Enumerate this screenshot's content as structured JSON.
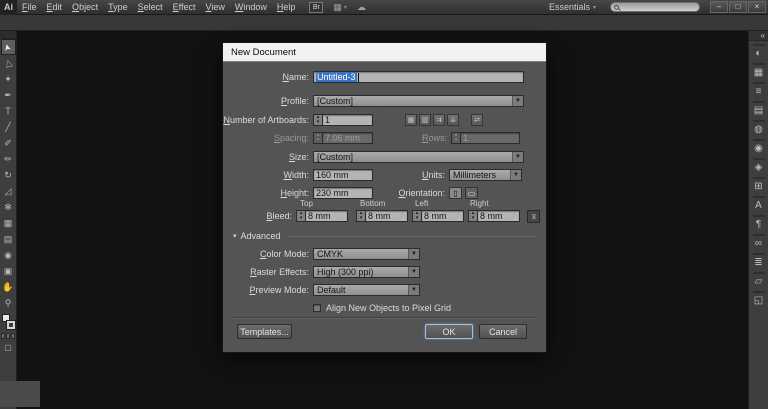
{
  "app": {
    "logo": "Ai",
    "menus": [
      "File",
      "Edit",
      "Object",
      "Type",
      "Select",
      "Effect",
      "View",
      "Window",
      "Help"
    ],
    "bridge_label": "Br",
    "workspace": "Essentials",
    "search_value": ""
  },
  "icons": {
    "arrange_documents": "▦",
    "cs_live": "☁",
    "workspace_caret": "▾",
    "dropdown_arrow": "▼",
    "stepper_up": "▴",
    "stepper_down": "▾",
    "minimize": "–",
    "restore": "□",
    "close": "×",
    "collapse_dock": "«",
    "advanced_caret": "▾",
    "link_bleed": "∞",
    "orientation_portrait": "▯",
    "orientation_landscape": "▭",
    "screen_mode": "▢"
  },
  "tools_panel": {
    "items": [
      {
        "name": "selection-tool",
        "glyph": "➤"
      },
      {
        "name": "direct-selection-tool",
        "glyph": "▷"
      },
      {
        "name": "magic-wand-tool",
        "glyph": "✦"
      },
      {
        "name": "pen-tool",
        "glyph": "✒"
      },
      {
        "name": "type-tool",
        "glyph": "T"
      },
      {
        "name": "line-segment-tool",
        "glyph": "╱"
      },
      {
        "name": "paintbrush-tool",
        "glyph": "✐"
      },
      {
        "name": "pencil-tool",
        "glyph": "✏"
      },
      {
        "name": "rotate-tool",
        "glyph": "↻"
      },
      {
        "name": "scale-tool",
        "glyph": "◿"
      },
      {
        "name": "symbol-sprayer-tool",
        "glyph": "✻"
      },
      {
        "name": "graph-tool",
        "glyph": "▦"
      },
      {
        "name": "gradient-tool",
        "glyph": "▤"
      },
      {
        "name": "eyedropper-tool",
        "glyph": "◉"
      },
      {
        "name": "artboard-tool",
        "glyph": "▣"
      },
      {
        "name": "hand-tool",
        "glyph": "✋"
      },
      {
        "name": "zoom-tool",
        "glyph": "⚲"
      }
    ]
  },
  "panels_dock": {
    "items": [
      {
        "name": "color-panel",
        "glyph": "◐"
      },
      {
        "name": "swatches-panel",
        "glyph": "▦"
      },
      {
        "name": "stroke-panel",
        "glyph": "≡"
      },
      {
        "name": "gradient-panel",
        "glyph": "▤"
      },
      {
        "name": "transparency-panel",
        "glyph": "◍"
      },
      {
        "name": "appearance-panel",
        "glyph": "◉"
      },
      {
        "name": "layers-panel",
        "glyph": "◈"
      },
      {
        "name": "artboards-panel",
        "glyph": "⊞"
      },
      {
        "name": "character-panel",
        "glyph": "A"
      },
      {
        "name": "paragraph-panel",
        "glyph": "¶"
      },
      {
        "name": "links-panel",
        "glyph": "∞"
      },
      {
        "name": "align-panel",
        "glyph": "≣"
      },
      {
        "name": "transform-panel",
        "glyph": "▱"
      },
      {
        "name": "pathfinder-panel",
        "glyph": "◱"
      }
    ]
  },
  "dialog": {
    "title": "New Document",
    "name": {
      "label": "Name:",
      "value": "Untitled-3"
    },
    "profile": {
      "label": "Profile:",
      "value": "[Custom]"
    },
    "artboards": {
      "label": "Number of Artboards:",
      "value": "1",
      "arrange_icons": [
        {
          "name": "grid-by-row-button",
          "glyph": "▦"
        },
        {
          "name": "grid-by-column-button",
          "glyph": "▥"
        },
        {
          "name": "arrange-by-row-button",
          "glyph": "⇉"
        },
        {
          "name": "arrange-by-column-button",
          "glyph": "⇊"
        },
        {
          "name": "change-layout-direction-button",
          "glyph": "⇄"
        }
      ]
    },
    "spacing": {
      "label": "Spacing:",
      "value": "7.06 mm"
    },
    "rows": {
      "label": "Rows:",
      "value": "1"
    },
    "size": {
      "label": "Size:",
      "value": "[Custom]"
    },
    "width": {
      "label": "Width:",
      "value": "160 mm"
    },
    "height": {
      "label": "Height:",
      "value": "230 mm"
    },
    "units": {
      "label": "Units:",
      "value": "Millimeters"
    },
    "orientation": {
      "label": "Orientation:"
    },
    "bleed": {
      "label": "Bleed:",
      "columns": [
        "Top",
        "Bottom",
        "Left",
        "Right"
      ],
      "values": [
        "8 mm",
        "8 mm",
        "8 mm",
        "8 mm"
      ]
    },
    "advanced": {
      "label": "Advanced",
      "color_mode": {
        "label": "Color Mode:",
        "value": "CMYK"
      },
      "raster_effects": {
        "label": "Raster Effects:",
        "value": "High (300 ppi)"
      },
      "preview_mode": {
        "label": "Preview Mode:",
        "value": "Default"
      },
      "pixel_grid": {
        "label": "Align New Objects to Pixel Grid",
        "checked": false
      }
    },
    "buttons": {
      "templates": "Templates...",
      "ok": "OK",
      "cancel": "Cancel"
    }
  }
}
